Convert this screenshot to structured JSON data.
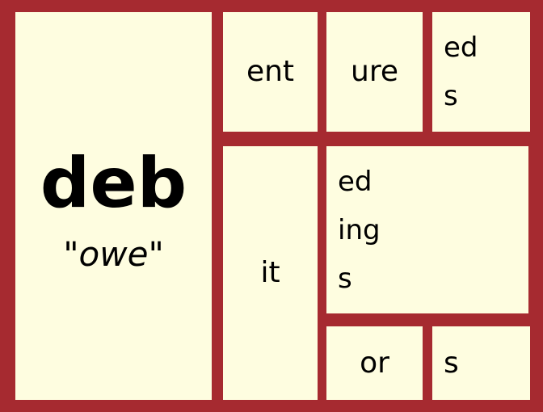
{
  "root": {
    "word": "deb",
    "meaning": "\"owe\""
  },
  "cells": {
    "ent": "ent",
    "ure": "ure",
    "ed_s": [
      "ed",
      "s"
    ],
    "it": "it",
    "ed_ing_s": [
      "ed",
      "ing",
      "s"
    ],
    "or": "or",
    "s": "s"
  },
  "colors": {
    "border": "#a62a30",
    "cell_background": "#fefde0",
    "text": "#000000"
  }
}
